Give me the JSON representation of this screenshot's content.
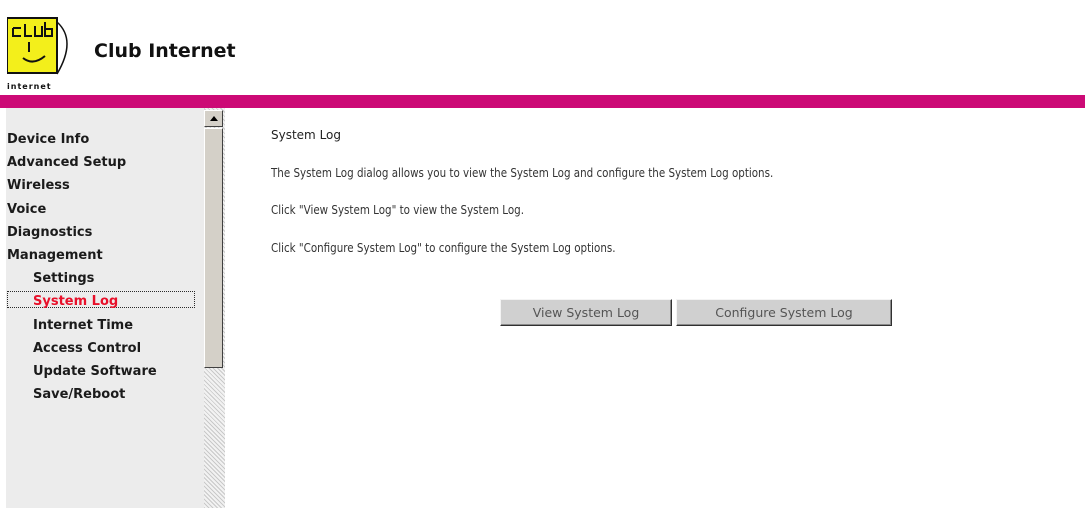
{
  "header": {
    "brand_name": "Club Internet",
    "logo_text": "club internet",
    "colors": {
      "logo_bg": "#f3ef1b",
      "accent_bar": "#cc0a76"
    }
  },
  "sidebar": {
    "items": [
      {
        "label": "Device Info",
        "level": 0,
        "active": false
      },
      {
        "label": "Advanced Setup",
        "level": 0,
        "active": false
      },
      {
        "label": "Wireless",
        "level": 0,
        "active": false
      },
      {
        "label": "Voice",
        "level": 0,
        "active": false
      },
      {
        "label": "Diagnostics",
        "level": 0,
        "active": false
      },
      {
        "label": "Management",
        "level": 0,
        "active": false
      },
      {
        "label": "Settings",
        "level": 1,
        "active": false
      },
      {
        "label": "System Log",
        "level": 1,
        "active": true
      },
      {
        "label": "Internet Time",
        "level": 1,
        "active": false
      },
      {
        "label": "Access Control",
        "level": 1,
        "active": false
      },
      {
        "label": "Update Software",
        "level": 1,
        "active": false
      },
      {
        "label": "Save/Reboot",
        "level": 1,
        "active": false
      }
    ],
    "active_color": "#e8102a"
  },
  "main": {
    "title": "System Log",
    "paragraphs": [
      "The System Log dialog allows you to view the System Log and configure the System Log options.",
      "Click \"View System Log\" to view the System Log.",
      "Click \"Configure System Log\" to configure the System Log options."
    ],
    "buttons": {
      "view": "View System Log",
      "configure": "Configure System Log"
    }
  }
}
